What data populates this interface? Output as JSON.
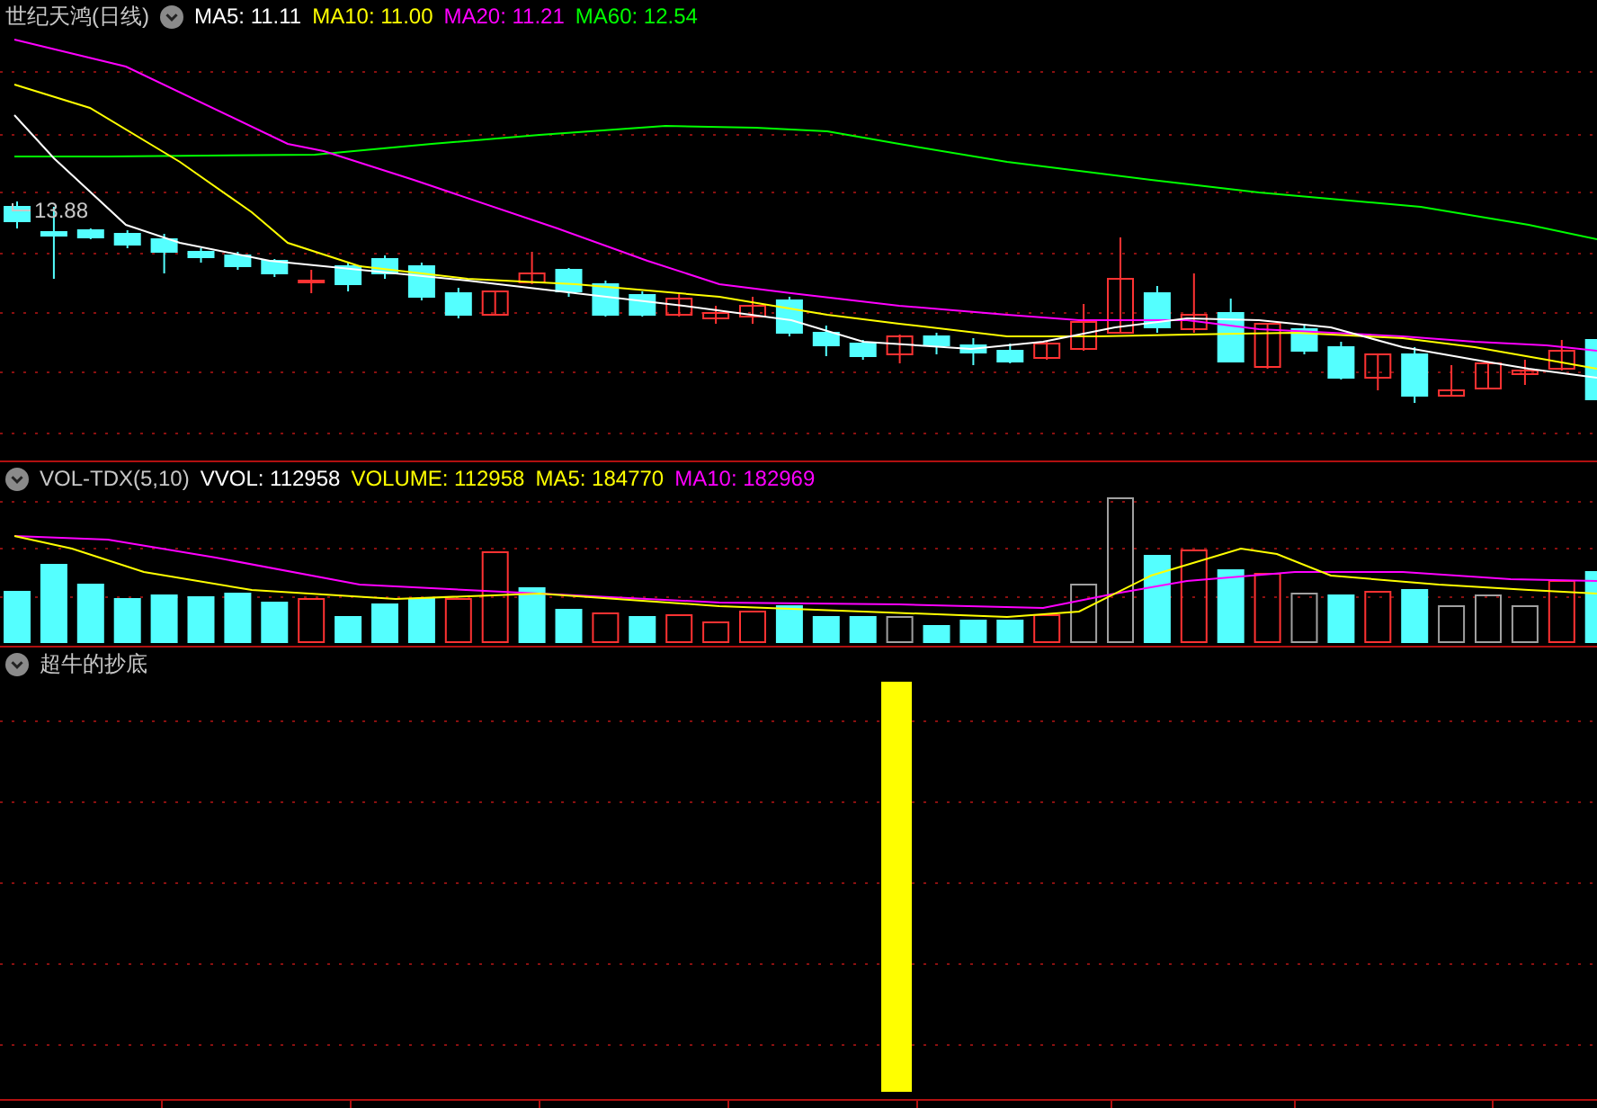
{
  "price_panel": {
    "title": "世纪天鸿(日线)",
    "indicators": [
      {
        "label": "MA5: 11.11",
        "color": "#ffffff"
      },
      {
        "label": "MA10: 11.00",
        "color": "#ffff00"
      },
      {
        "label": "MA20: 11.21",
        "color": "#ff00ff"
      },
      {
        "label": "MA60: 12.54",
        "color": "#00ff00"
      }
    ],
    "max_price_label": "13.88"
  },
  "volume_panel": {
    "title": "VOL-TDX(5,10)",
    "indicators": [
      {
        "label": "VVOL: 112958",
        "color": "#ffffff"
      },
      {
        "label": "VOLUME: 112958",
        "color": "#ffff00"
      },
      {
        "label": "MA5: 184770",
        "color": "#ffff00"
      },
      {
        "label": "MA10: 182969",
        "color": "#ff00ff"
      }
    ]
  },
  "signal_panel": {
    "title": "超牛的抄底"
  }
}
